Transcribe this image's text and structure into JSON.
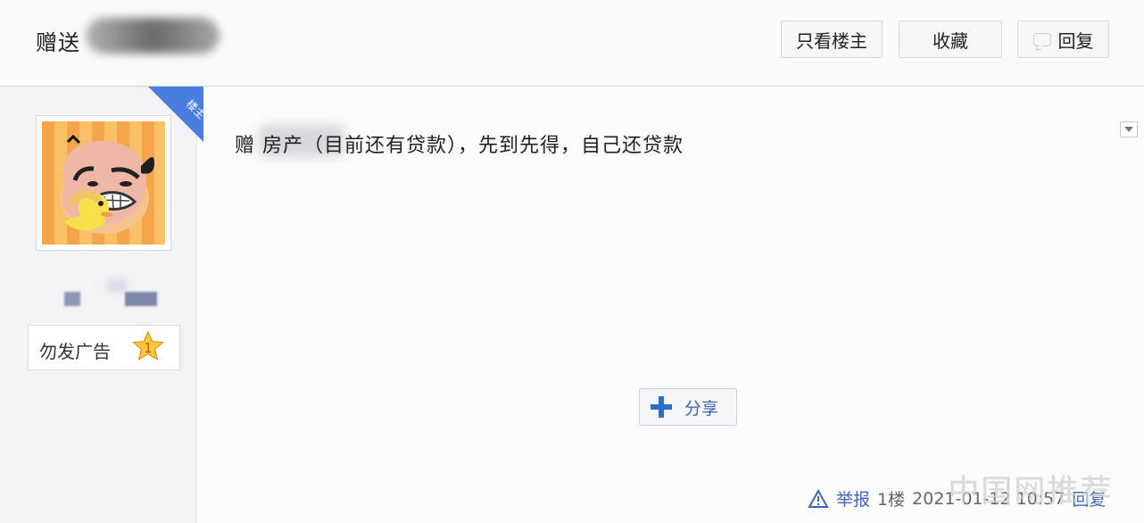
{
  "header": {
    "title": "赠送",
    "buttons": {
      "only_op": "只看楼主",
      "favorite": "收藏",
      "reply": "回复"
    }
  },
  "author": {
    "badge_text": "楼主",
    "level_label": "勿发广告",
    "level_number": "1"
  },
  "post": {
    "content": "赠 房产（目前还有贷款），先到先得，自己还贷款",
    "share_label": "分享"
  },
  "footer": {
    "report": "举报",
    "floor": "1楼",
    "datetime": "2021-01-12 10:57",
    "reply": "回复"
  },
  "watermark": "中国网推荐",
  "colors": {
    "accent": "#3e66b2",
    "ribbon": "#4a7bdf",
    "avatar_orange": "#f6a54a"
  }
}
